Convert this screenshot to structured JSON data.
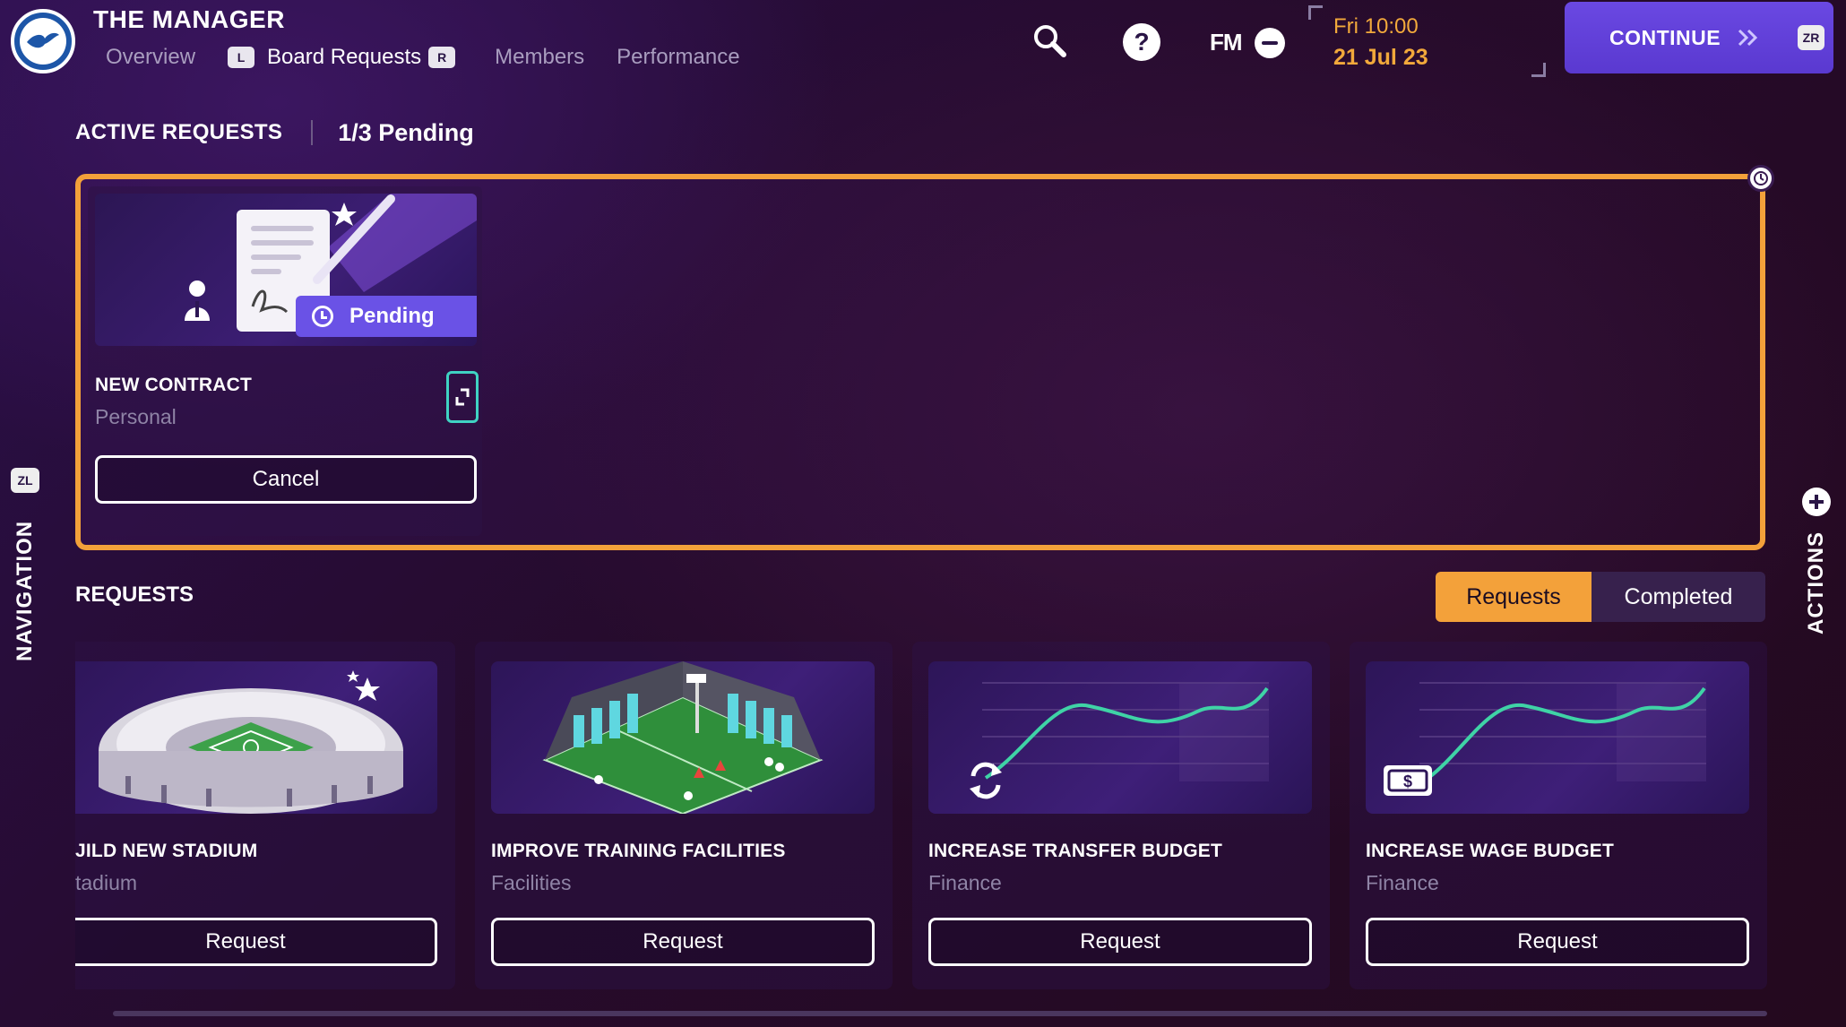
{
  "header": {
    "title": "THE MANAGER",
    "left_hint": "L",
    "right_hint": "R",
    "tabs": [
      {
        "label": "Overview",
        "active": false
      },
      {
        "label": "Board Requests",
        "active": true
      },
      {
        "label": "Members",
        "active": false
      },
      {
        "label": "Performance",
        "active": false
      }
    ],
    "fm_label": "FM",
    "date_time": "Fri 10:00",
    "date_day": "21 Jul 23",
    "continue_label": "CONTINUE",
    "continue_hint": "ZR"
  },
  "side": {
    "navigation_hint": "ZL",
    "navigation_label": "NAVIGATION",
    "actions_label": "ACTIONS"
  },
  "active_requests": {
    "title": "ACTIVE REQUESTS",
    "count": "1/3 Pending",
    "card": {
      "status": "Pending",
      "title": "NEW CONTRACT",
      "category": "Personal",
      "button": "Cancel"
    }
  },
  "requests": {
    "title": "REQUESTS",
    "toggle": {
      "active": "Requests",
      "inactive": "Completed"
    },
    "cards": [
      {
        "title": "JILD NEW STADIUM",
        "category": "tadium",
        "button": "Request",
        "image": "stadium"
      },
      {
        "title": "IMPROVE TRAINING FACILITIES",
        "category": "Facilities",
        "button": "Request",
        "image": "training-ground"
      },
      {
        "title": "INCREASE TRANSFER BUDGET",
        "category": "Finance",
        "button": "Request",
        "image": "transfer-graph"
      },
      {
        "title": "INCREASE WAGE BUDGET",
        "category": "Finance",
        "button": "Request",
        "image": "wage-graph"
      }
    ]
  },
  "colors": {
    "accent_orange": "#f3a13a",
    "continue_purple": "#5a39d0",
    "pending_badge": "#6a52e6",
    "graph_teal": "#3fd3a6"
  }
}
